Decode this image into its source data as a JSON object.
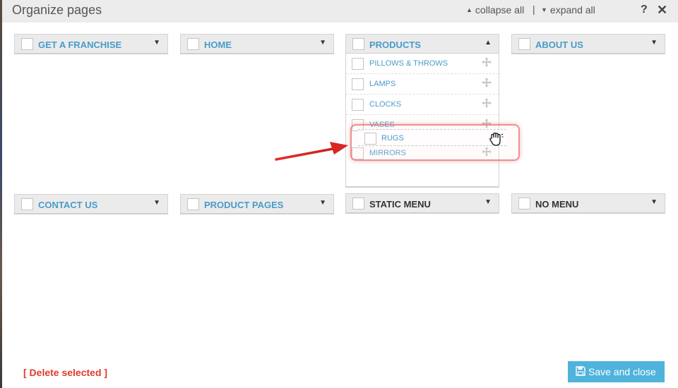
{
  "header": {
    "title": "Organize pages",
    "collapse_label": "collapse all",
    "separator": "|",
    "expand_label": "expand all",
    "help_label": "?",
    "close_label": "✕"
  },
  "menus": {
    "get_a_franchise": "GET A FRANCHISE",
    "home": "HOME",
    "products": "PRODUCTS",
    "about_us": "ABOUT US",
    "contact_us": "CONTACT US",
    "product_pages": "PRODUCT PAGES",
    "static_menu": "STATIC MENU",
    "no_menu": "NO MENU"
  },
  "products_items": [
    "PILLOWS & THROWS",
    "LAMPS",
    "CLOCKS",
    "VASES",
    "MIRRORS"
  ],
  "dragging_item": "RUGS",
  "footer": {
    "delete_label": "[ Delete selected ]",
    "save_label": "Save and close"
  },
  "colors": {
    "accent": "#4a9bc9",
    "save_button": "#4fb3dc",
    "delete": "#e03a2f",
    "annotation": "#e0302a"
  },
  "icons": {
    "collapse": "triangle-up-icon",
    "expand": "triangle-down-icon",
    "move": "move-icon",
    "save": "floppy-disk-icon",
    "cursor": "grab-hand-icon"
  }
}
